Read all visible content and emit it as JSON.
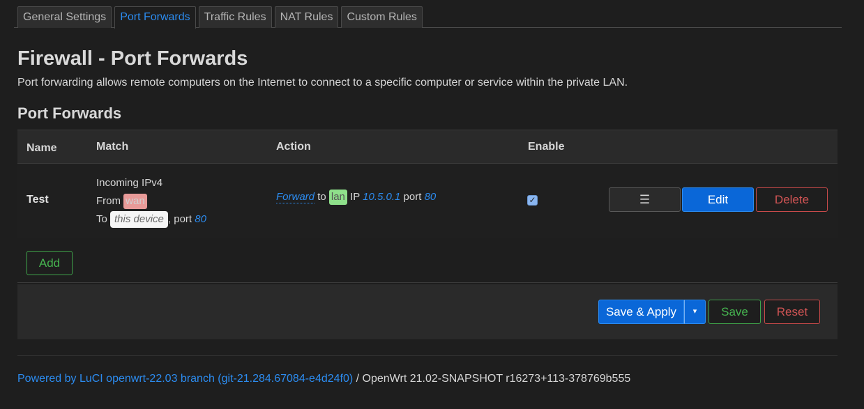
{
  "tabs": [
    {
      "label": "General Settings",
      "active": false
    },
    {
      "label": "Port Forwards",
      "active": true
    },
    {
      "label": "Traffic Rules",
      "active": false
    },
    {
      "label": "NAT Rules",
      "active": false
    },
    {
      "label": "Custom Rules",
      "active": false
    }
  ],
  "page": {
    "title": "Firewall - Port Forwards",
    "description": "Port forwarding allows remote computers on the Internet to connect to a specific computer or service within the private LAN."
  },
  "section": {
    "title": "Port Forwards",
    "columns": {
      "name": "Name",
      "match": "Match",
      "action": "Action",
      "enable": "Enable"
    },
    "rules": [
      {
        "name": "Test",
        "match": {
          "line1": "Incoming IPv4",
          "from_prefix": "From",
          "from_zone": "wan",
          "to_prefix": "To",
          "to_target": "this device",
          "port_prefix": ", port",
          "port": "80"
        },
        "action": {
          "verb": "Forward",
          "to": "to",
          "zone": "lan",
          "ip_prefix": "IP",
          "ip": "10.5.0.1",
          "port_prefix": "port",
          "port": "80"
        },
        "enabled": true,
        "enabled_glyph": "✓",
        "buttons": {
          "drag": "☰",
          "edit": "Edit",
          "delete": "Delete"
        }
      }
    ],
    "add_label": "Add"
  },
  "footer_actions": {
    "save_apply": "Save & Apply",
    "save_apply_dropdown": "▾",
    "save": "Save",
    "reset": "Reset"
  },
  "footer": {
    "powered_link": "Powered by LuCI openwrt-22.03 branch (git-21.284.67084-e4d24f0)",
    "powered_rest": " / OpenWrt 21.02-SNAPSHOT r16273+113-378769b555"
  },
  "colors": {
    "accent": "#2c8cf0",
    "primary_button": "#0a67d8",
    "positive": "#46b450",
    "negative": "#d05454",
    "wan_badge": "#e89a98",
    "lan_badge": "#8fe08b"
  }
}
